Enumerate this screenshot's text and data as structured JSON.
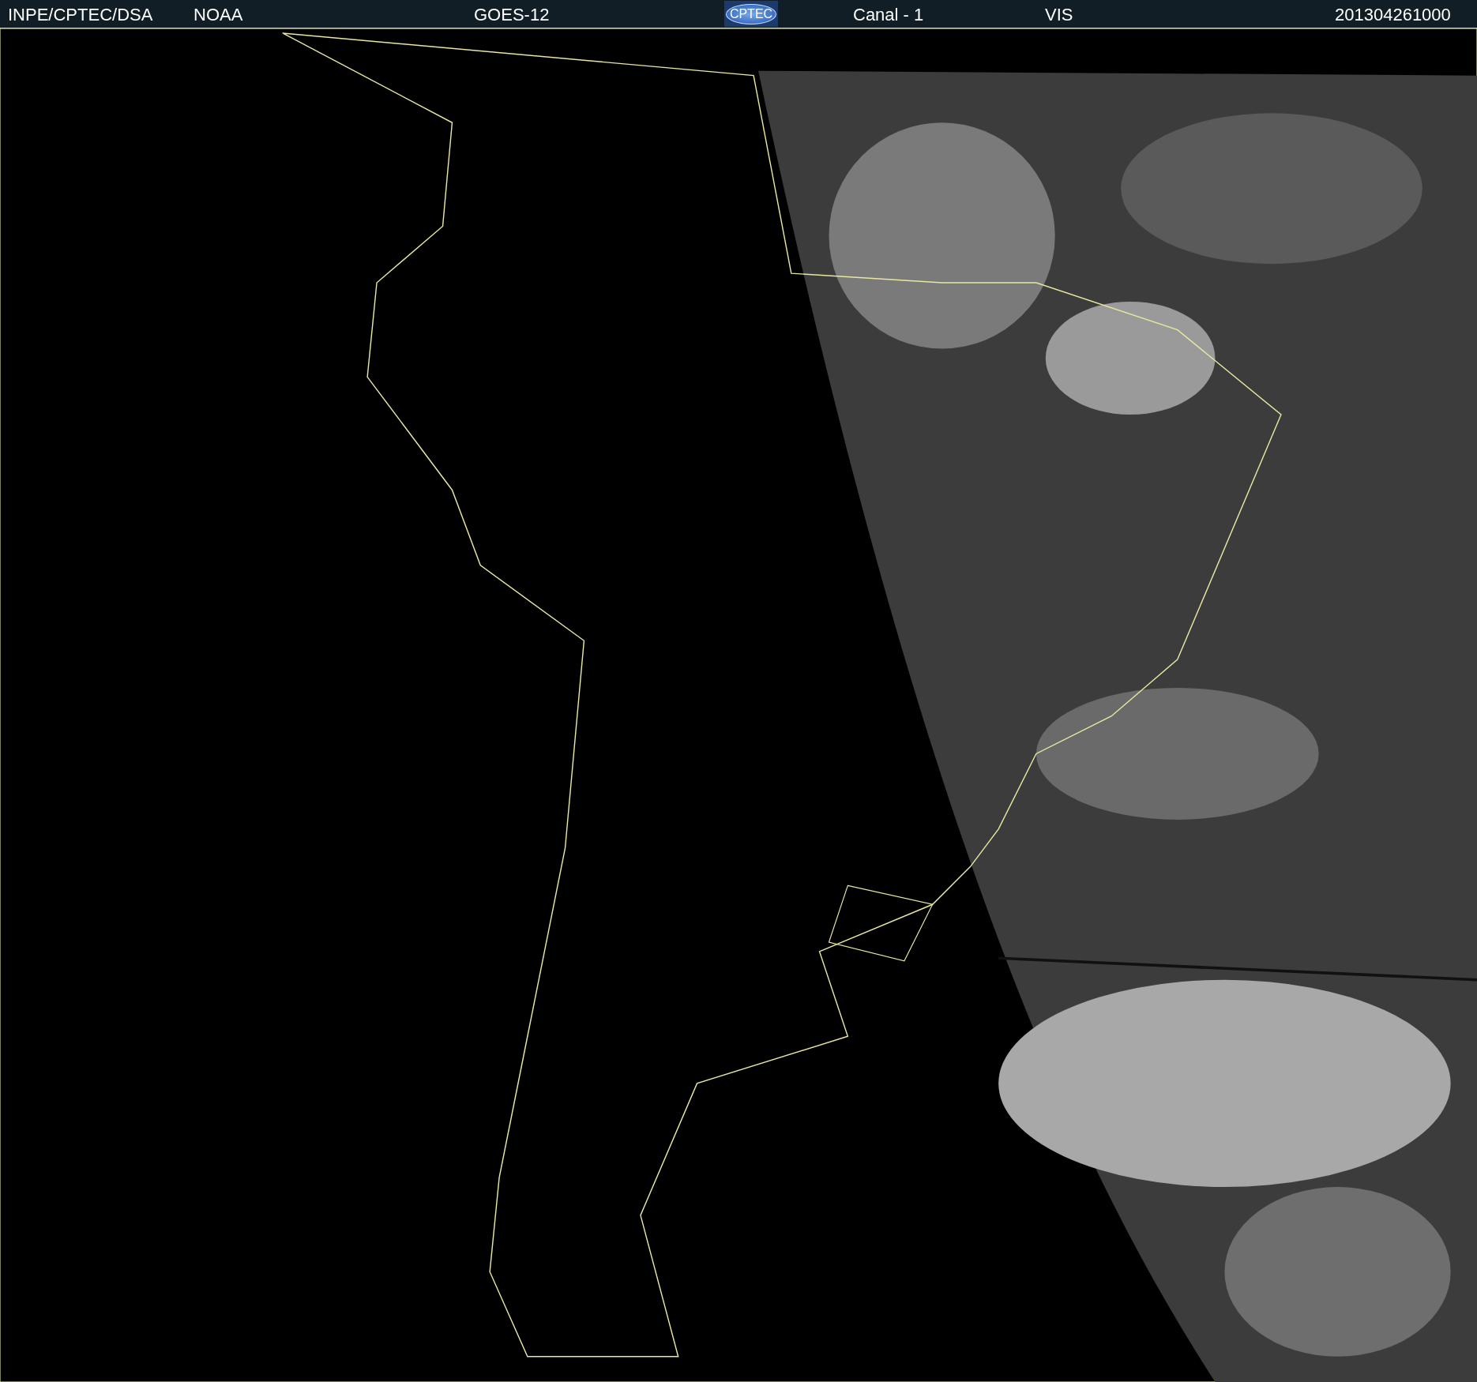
{
  "header": {
    "items": [
      {
        "kind": "text",
        "text": "INPE/CPTEC/DSA"
      },
      {
        "kind": "text",
        "text": "NOAA"
      },
      {
        "kind": "text",
        "text": "GOES-12"
      },
      {
        "kind": "logo",
        "text": "CPTEC"
      },
      {
        "kind": "text",
        "text": "Canal - 1"
      },
      {
        "kind": "text",
        "text": "VIS"
      },
      {
        "kind": "text",
        "text": "201304261000"
      }
    ]
  }
}
